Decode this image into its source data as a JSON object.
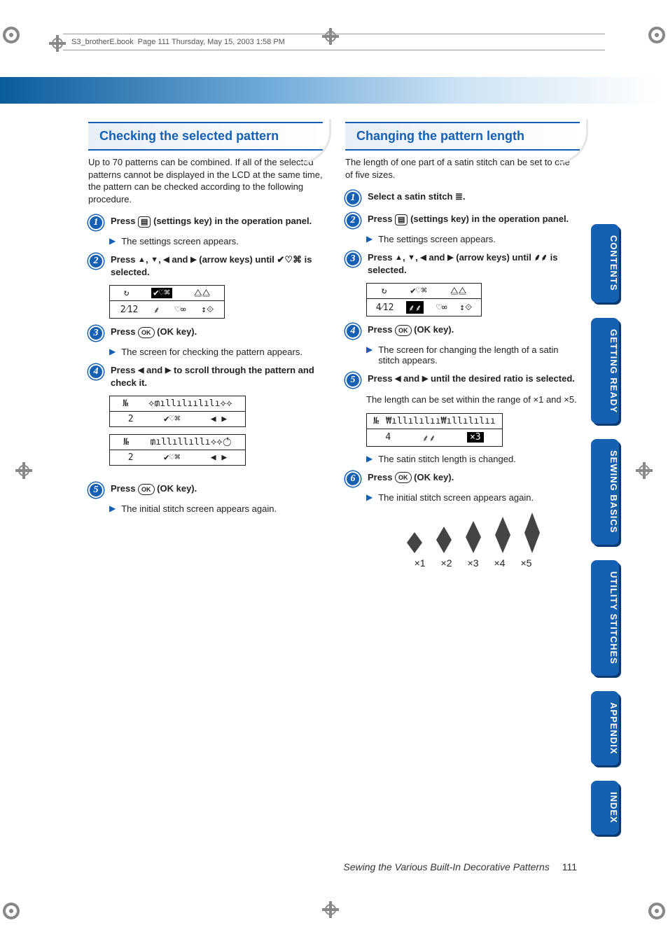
{
  "header": {
    "filename": "S3_brotherE.book",
    "pageinfo": "Page 111  Thursday, May 15, 2003  1:58 PM"
  },
  "tabs": [
    "CONTENTS",
    "GETTING READY",
    "SEWING BASICS",
    "UTILITY STITCHES",
    "APPENDIX",
    "INDEX"
  ],
  "left": {
    "title": "Checking the selected pattern",
    "intro": "Up to 70 patterns can be combined. If all of the selected patterns cannot be displayed in the LCD at the same time, the pattern can be checked according to the following procedure.",
    "step1": "Press",
    "step1b": "(settings key) in the operation panel.",
    "sub1": "The settings screen appears.",
    "step2a": "Press",
    "step2b": "and",
    "step2c": "(arrow keys) until",
    "step2d": "is selected.",
    "lcd1_left": "2⁄12",
    "step3a": "Press",
    "step3b": "(OK key).",
    "sub3": "The screen for checking the pattern appears.",
    "step4a": "Press",
    "step4b": "and",
    "step4c": "to scroll through the pattern and check it.",
    "lcd2_row2a": "2",
    "lcd3_row2a": "2",
    "step5a": "Press",
    "step5b": "(OK key).",
    "sub5": "The initial stitch screen appears again."
  },
  "right": {
    "title": "Changing the pattern length",
    "intro": "The length of one part of a satin stitch can be set to one of five sizes.",
    "step1a": "Select a satin stitch",
    "step1b": ".",
    "step2a": "Press",
    "step2b": "(settings key) in the operation panel.",
    "sub2": "The settings screen appears.",
    "step3a": "Press",
    "step3b": "and",
    "step3c": "(arrow keys) until",
    "step3d": "is selected.",
    "lcd1_left": "4⁄12",
    "step4a": "Press",
    "step4b": "(OK key).",
    "sub4": "The screen for changing the length of a satin stitch appears.",
    "step5a": "Press",
    "step5b": "and",
    "step5c": "until the desired ratio is selected.",
    "step5_note1": "The length can be set within the range of ",
    "step5_note1b": "×1",
    "step5_note2": " and ",
    "step5_note2b": "×5",
    "step5_note3": ".",
    "lcd2_row2a": "4",
    "lcd2_row2b": "×3",
    "sub5b": "The satin stitch length is changed.",
    "step6a": "Press",
    "step6b": "(OK key).",
    "sub6": "The initial stitch screen appears again.",
    "ratios": [
      "×1",
      "×2",
      "×3",
      "×4",
      "×5"
    ]
  },
  "footer": {
    "chapter": "Sewing the Various Built-In Decorative Patterns",
    "page": "111"
  }
}
